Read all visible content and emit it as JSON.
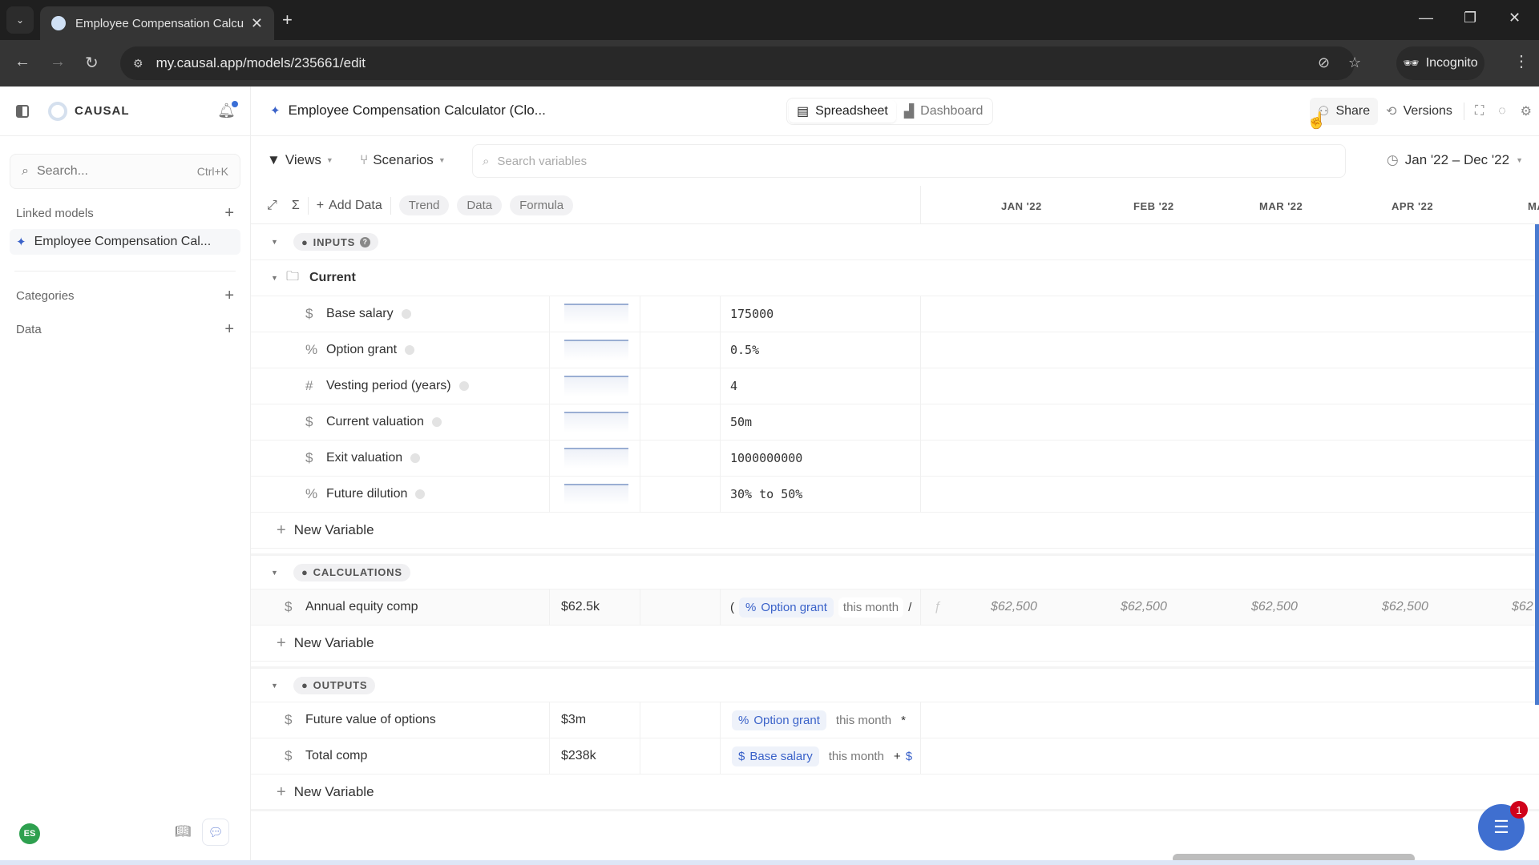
{
  "browser": {
    "tab_title": "Employee Compensation Calcul",
    "url": "my.causal.app/models/235661/edit",
    "incognito_label": "Incognito"
  },
  "sidebar": {
    "brand": "CAUSAL",
    "search_placeholder": "Search...",
    "search_shortcut": "Ctrl+K",
    "linked_models_label": "Linked models",
    "linked_model_item": "Employee Compensation Cal...",
    "categories_label": "Categories",
    "data_label": "Data",
    "avatar_initials": "ES"
  },
  "header": {
    "doc_title": "Employee Compensation Calculator (Clo...",
    "views": [
      {
        "label": "Spreadsheet",
        "active": true
      },
      {
        "label": "Dashboard",
        "active": false
      }
    ],
    "share_label": "Share",
    "versions_label": "Versions"
  },
  "toolbar": {
    "views_label": "Views",
    "scenarios_label": "Scenarios",
    "search_placeholder": "Search variables",
    "date_range": "Jan '22 – Dec '22"
  },
  "grid_tools": {
    "add_data_label": "Add Data",
    "pills": [
      "Trend",
      "Data",
      "Formula"
    ],
    "months": [
      "JAN '22",
      "FEB '22",
      "MAR '22",
      "APR '22",
      "MA"
    ]
  },
  "groups": {
    "inputs": {
      "label": "INPUTS",
      "folder": "Current",
      "variables": [
        {
          "type": "$",
          "name": "Base salary",
          "value": "175000"
        },
        {
          "type": "%",
          "name": "Option grant",
          "value": "0.5%"
        },
        {
          "type": "#",
          "name": "Vesting period (years)",
          "value": "4"
        },
        {
          "type": "$",
          "name": "Current valuation",
          "value": "50m"
        },
        {
          "type": "$",
          "name": "Exit valuation",
          "value": "1000000000"
        },
        {
          "type": "%",
          "name": "Future dilution",
          "value": "30% to 50%"
        }
      ]
    },
    "calculations": {
      "label": "CALCULATIONS",
      "variables": [
        {
          "type": "$",
          "name": "Annual equity comp",
          "summary": "$62.5k",
          "formula": {
            "prefix": "(",
            "chip_type": "%",
            "chip": "Option grant",
            "ctx": "this month",
            "op": "/"
          },
          "monthly": [
            "$62,500",
            "$62,500",
            "$62,500",
            "$62,500",
            "$62"
          ]
        }
      ]
    },
    "outputs": {
      "label": "OUTPUTS",
      "variables": [
        {
          "type": "$",
          "name": "Future value of options",
          "summary": "$3m",
          "formula": {
            "chip_type": "%",
            "chip": "Option grant",
            "ctx": "this month",
            "op": "*"
          }
        },
        {
          "type": "$",
          "name": "Total comp",
          "summary": "$238k",
          "formula": {
            "chip_type": "$",
            "chip": "Base salary",
            "ctx": "this month",
            "op": "+",
            "trail": "$"
          }
        }
      ]
    },
    "new_variable_label": "New Variable"
  },
  "intercom": {
    "badge": "1"
  }
}
